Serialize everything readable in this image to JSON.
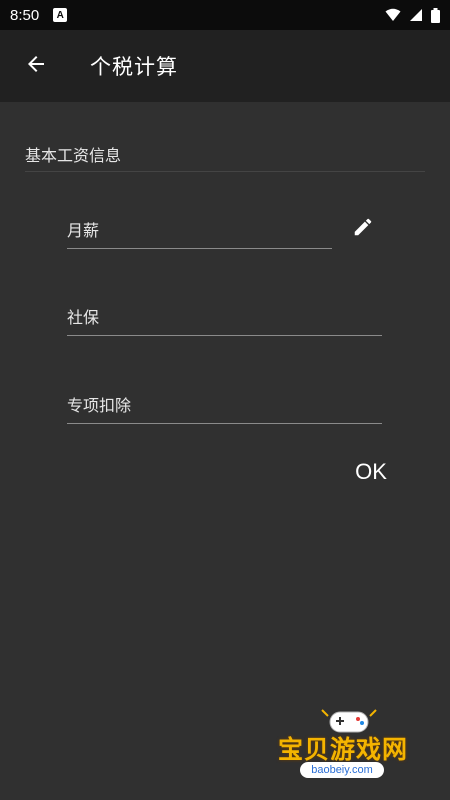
{
  "status_bar": {
    "time": "8:50",
    "app_icon_letter": "A"
  },
  "app_bar": {
    "title": "个税计算"
  },
  "section": {
    "title": "基本工资信息"
  },
  "fields": {
    "monthly_salary": {
      "label": "月薪"
    },
    "social_security": {
      "label": "社保"
    },
    "special_deduction": {
      "label": "专项扣除"
    }
  },
  "actions": {
    "ok_label": "OK"
  },
  "watermark": {
    "name": "宝贝游戏网",
    "url": "baobeiy.com"
  },
  "colors": {
    "background": "#303030",
    "app_bar": "#212121",
    "status_bar": "#0c0c0c",
    "text": "#ffffff",
    "watermark": "#f4b400"
  }
}
